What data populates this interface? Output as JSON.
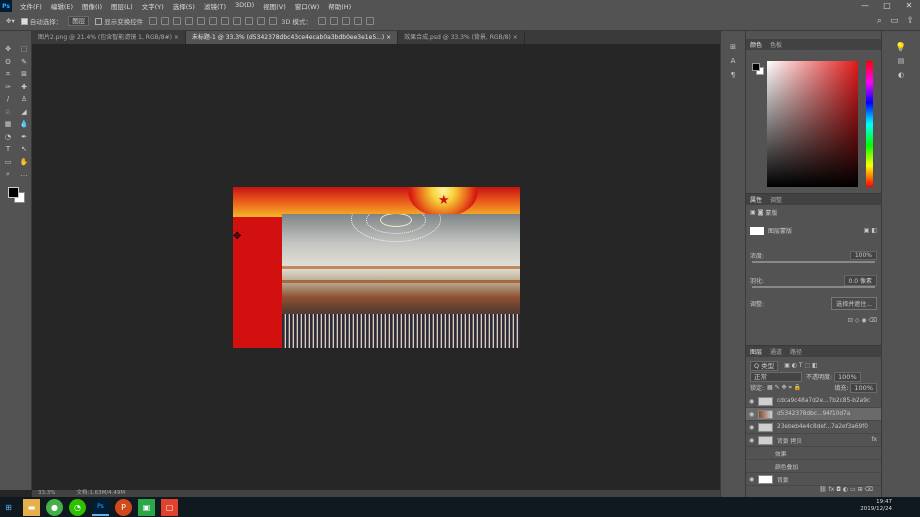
{
  "app": {
    "logo": "Ps"
  },
  "menubar": {
    "items": [
      "文件(F)",
      "编辑(E)",
      "图像(I)",
      "图层(L)",
      "文字(Y)",
      "选择(S)",
      "滤镜(T)",
      "3D(D)",
      "视图(V)",
      "窗口(W)",
      "帮助(H)"
    ],
    "window_controls": [
      "—",
      "□",
      "✕"
    ]
  },
  "options": {
    "auto_select_label": "自动选择：",
    "auto_select_value": "图层",
    "show_transform_label": "显示变换控件",
    "threed_mode_label": "3D 模式："
  },
  "tabs": [
    "图片2.png @ 21.4% (包含智能滤镜 1, RGB/8#)",
    "未标题-1 @ 33.3% (d5342378dbc43ce4ecab0a3bdb0ee3e1e5...)",
    "效果合成.psd @ 33.3% (背景, RGB/8)"
  ],
  "statusbar": {
    "zoom": "33.3%",
    "info": "文档:1.63M/4.49M"
  },
  "panels": {
    "color_tabs": [
      "颜色",
      "色板"
    ],
    "properties_tabs": [
      "属性",
      "调整"
    ],
    "properties_type": "蒙版",
    "mask_label": "图层蒙版",
    "density_label": "浓度:",
    "density_value": "100%",
    "feather_label": "羽化:",
    "feather_value": "0.0 像素",
    "refine_label": "调整:",
    "select_subject_button": "选择并遮住...",
    "layers_tabs": [
      "图层",
      "通道",
      "路径"
    ],
    "kind_filter": "Q 类型",
    "blend_mode": "正常",
    "opacity_label": "不透明度:",
    "opacity_value": "100%",
    "lock_label": "锁定:",
    "fill_label": "填充:",
    "fill_value": "100%"
  },
  "layers": [
    {
      "name": "cdca9c48a7d2e...7b2c85-b2a9c"
    },
    {
      "name": "d5342378dbc...94f10d7a"
    },
    {
      "name": "23ebeb4e4c8def...7a2ef3a69f0"
    },
    {
      "name": "背景 拷贝",
      "fx": "fx"
    },
    {
      "name": "效果"
    },
    {
      "name": "颜色叠加"
    },
    {
      "name": "背景"
    }
  ],
  "taskbar": {
    "time": "19:47",
    "date": "2019/12/24"
  },
  "colors": {
    "panel": "#535353",
    "canvas_bg": "#262626",
    "red": "#d31010"
  }
}
